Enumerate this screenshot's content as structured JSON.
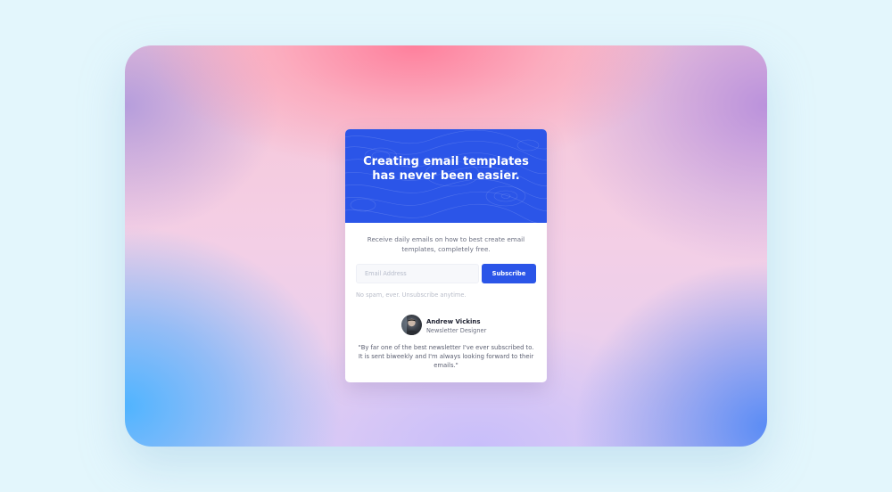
{
  "card": {
    "title": "Creating email templates has never been easier.",
    "description": "Receive daily emails on how to best create email templates, completely free.",
    "email_placeholder": "Email Address",
    "subscribe_label": "Subscribe",
    "note": "No spam, ever. Unsubscribe anytime.",
    "author": {
      "name": "Andrew Vickins",
      "role": "Newsletter Designer"
    },
    "quote": "\"By far one of the best newsletter I've ever subscribed to. It is sent biweekly and I'm always looking forward to their emails.\""
  },
  "colors": {
    "accent": "#2b55e8",
    "page_background": "#e3f6fc"
  },
  "icons": {
    "header_pattern": "topographic-lines",
    "avatar": "person-photo"
  }
}
